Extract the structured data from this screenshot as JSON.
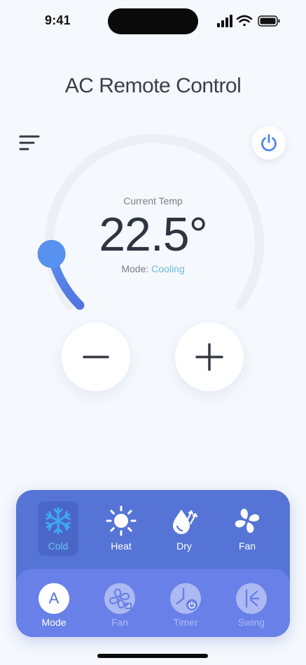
{
  "status_bar": {
    "time": "9:41",
    "icons": [
      "signal-icon",
      "wifi-icon",
      "battery-icon"
    ]
  },
  "header": {
    "title": "AC Remote Control"
  },
  "thermostat": {
    "current_label": "Current Temp",
    "temperature": "22.5°",
    "mode_prefix": "Mode: ",
    "mode_value": "Cooling",
    "dial_level": 0.12
  },
  "modes": [
    {
      "label": "Cold",
      "icon": "snowflake-icon",
      "active": true
    },
    {
      "label": "Heat",
      "icon": "sun-icon",
      "active": false
    },
    {
      "label": "Dry",
      "icon": "droplet-icon",
      "active": false
    },
    {
      "label": "Fan",
      "icon": "fan-icon",
      "active": false
    }
  ],
  "bottom_nav": [
    {
      "label": "Mode",
      "icon_letter": "A",
      "active": true
    },
    {
      "label": "Fan",
      "icon": "fan-speed-icon",
      "active": false
    },
    {
      "label": "Timer",
      "icon": "timer-icon",
      "active": false
    },
    {
      "label": "Swing",
      "icon": "swing-icon",
      "active": false
    }
  ],
  "colors": {
    "accent": "#4f86ec",
    "panel": "#5574d6",
    "panel_light": "#6880e8",
    "mode_highlight": "#6bbad9"
  }
}
